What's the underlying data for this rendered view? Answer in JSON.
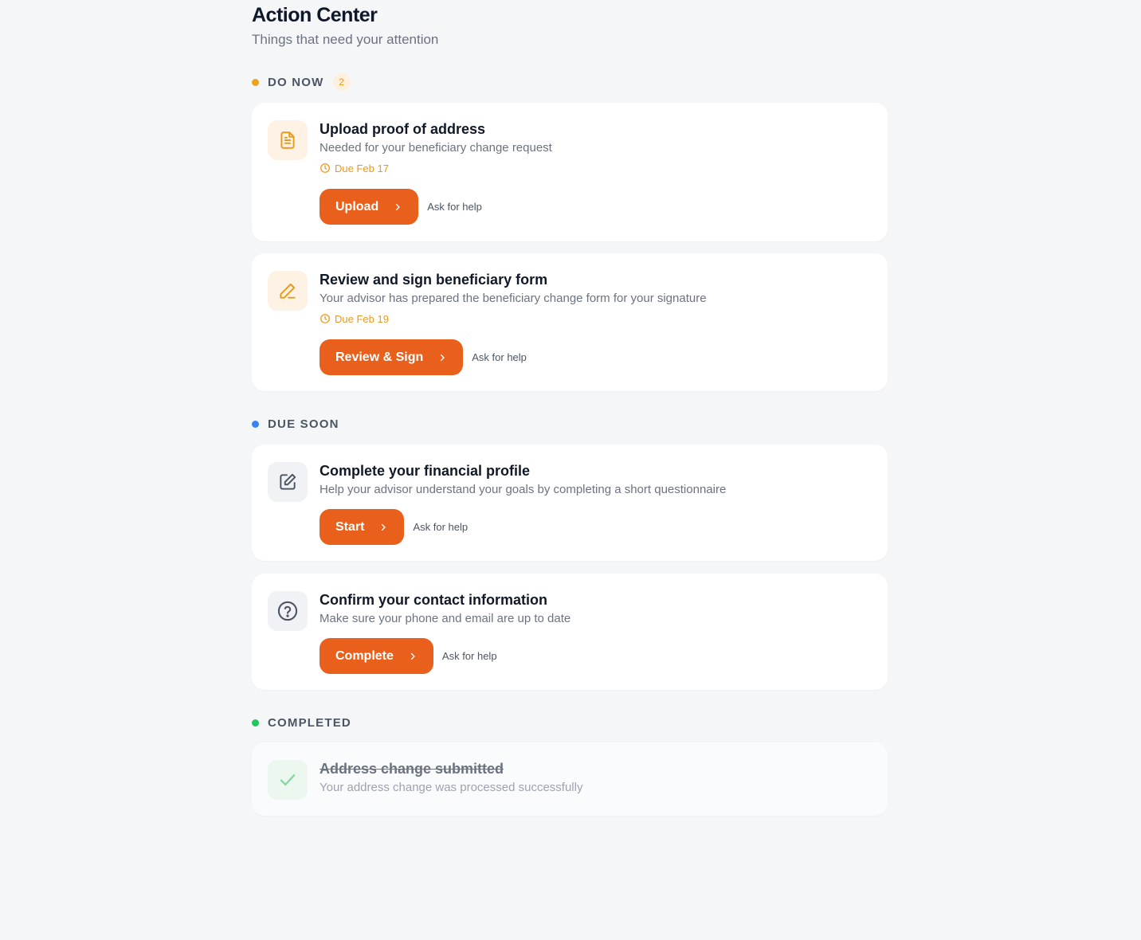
{
  "header": {
    "title": "Action Center",
    "subtitle": "Things that need your attention"
  },
  "sections": {
    "do_now": {
      "label": "DO NOW",
      "count": "2",
      "dot_color": "#f0a21b"
    },
    "due_soon": {
      "label": "DUE SOON",
      "dot_color": "#3b82f6"
    },
    "completed": {
      "label": "COMPLETED",
      "dot_color": "#22c55e"
    }
  },
  "tasks": [
    {
      "icon": "document-icon",
      "title": "Upload proof of address",
      "description": "Needed for your beneficiary change request",
      "due": "Due Feb 17",
      "button": "Upload",
      "help": "Ask for help"
    },
    {
      "icon": "pen-icon",
      "title": "Review and sign beneficiary form",
      "description": "Your advisor has prepared the beneficiary change form for your signature",
      "due": "Due Feb 19",
      "button": "Review & Sign",
      "help": "Ask for help"
    },
    {
      "icon": "edit-square-icon",
      "title": "Complete your financial profile",
      "description": "Help your advisor understand your goals by completing a short questionnaire",
      "button": "Start",
      "help": "Ask for help"
    },
    {
      "icon": "question-circle-icon",
      "title": "Confirm your contact information",
      "description": "Make sure your phone and email are up to date",
      "button": "Complete",
      "help": "Ask for help"
    }
  ],
  "completed": [
    {
      "icon": "check-icon",
      "title": "Address change submitted",
      "description": "Your address change was processed successfully"
    }
  ],
  "colors": {
    "accent": "#e8601c",
    "warning": "#e89a1d",
    "background": "#f5f6f8"
  }
}
